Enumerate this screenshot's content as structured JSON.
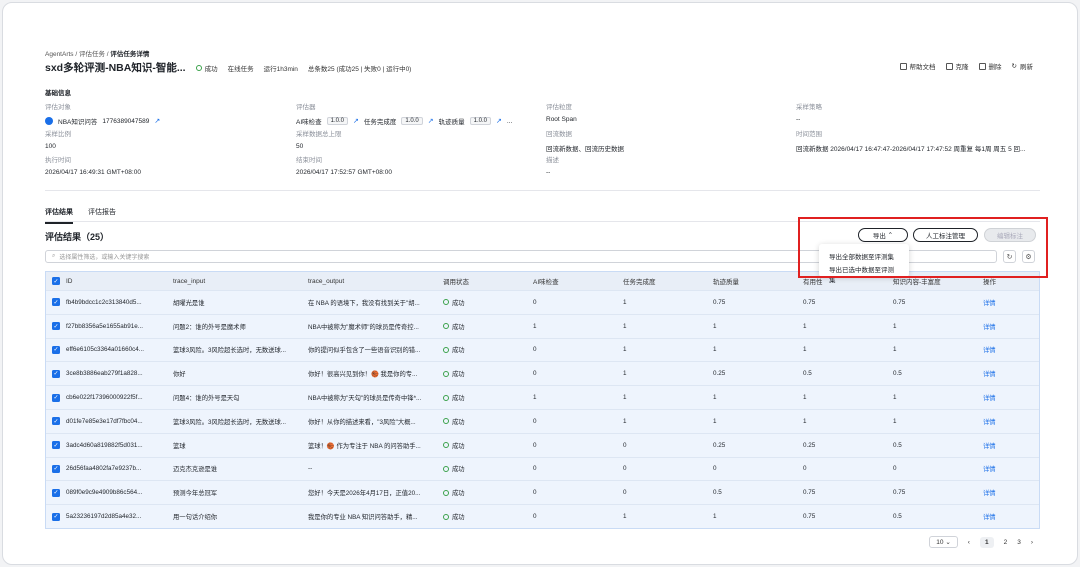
{
  "breadcrumb": [
    "AgentArts",
    "评估任务",
    "评估任务详情"
  ],
  "header": {
    "title": "sxd多轮评测-NBA知识-智能...",
    "status": "成功",
    "task_type": "在线任务",
    "duration": "运行1h3min",
    "summary": "总条数25 (成功25 | 失败0 | 运行中0)",
    "actions": [
      "帮助文档",
      "克隆",
      "删除",
      "刷新"
    ]
  },
  "basic": {
    "section_title": "基础信息",
    "fields": [
      {
        "label": "评估对象",
        "value": "NBA知识问答",
        "extra": "1776389047589"
      },
      {
        "label": "评估器",
        "items": [
          {
            "name": "AI味检查",
            "ver": "1.0.0"
          },
          {
            "name": "任务完成度",
            "ver": "1.0.0"
          },
          {
            "name": "轨迹质量",
            "ver": "1.0.0"
          }
        ],
        "more": "..."
      },
      {
        "label": "评估粒度",
        "value": "Root Span"
      },
      {
        "label": "采样策略",
        "value": "--"
      },
      {
        "label": "采样比例",
        "value": "100"
      },
      {
        "label": "采样数据总上限",
        "value": "50"
      },
      {
        "label": "回流数据",
        "value": "回流新数据、回流历史数据"
      },
      {
        "label": "时间范围",
        "value": "回流新数据 2026/04/17 16:47:47-2026/04/17 17:47:52 周重复 每1周 周五 5 回..."
      },
      {
        "label": "执行时间",
        "value": "2026/04/17 16:49:31 GMT+08:00"
      },
      {
        "label": "结束时间",
        "value": "2026/04/17 17:52:57 GMT+08:00"
      },
      {
        "label": "描述",
        "value": "--"
      }
    ]
  },
  "tabs": [
    "评估结果",
    "评估报告"
  ],
  "results": {
    "title": "评估结果（25）",
    "search_placeholder": "选择属性筛选，或输入关键字搜索",
    "export_label": "导出",
    "annotate_label": "人工标注管理",
    "edit_label": "编辑标注",
    "export_menu": [
      "导出全部数据至评测集",
      "导出已选中数据至评测集"
    ],
    "columns": [
      "ID",
      "trace_input",
      "trace_output",
      "调用状态",
      "AI味检查",
      "任务完成度",
      "轨迹质量",
      "有用性",
      "知识内容-丰富度",
      "操作"
    ],
    "rows": [
      [
        "fb4b9bdcc1c2c313840d5...",
        "胡曜光是谁",
        "在 NBA 的语境下，我没有找到关于\"胡...",
        "成功",
        "0",
        "1",
        "0.75",
        "0.75",
        "0.75",
        "详情"
      ],
      [
        "f27bb8356a5e1655ab91e...",
        "问题2：谁的外号是魔术师",
        "NBA中被称为\"魔术师\"的球员是传奇控...",
        "成功",
        "1",
        "1",
        "1",
        "1",
        "1",
        "详情"
      ],
      [
        "eff6e6105c3364a01660c4...",
        "篮球3风险。3风险超长选时，无数送球...",
        "你的提问似乎包含了一些语音识别的错...",
        "成功",
        "0",
        "1",
        "1",
        "1",
        "1",
        "详情"
      ],
      [
        "3ce8b3886eab279f1a828...",
        "你好",
        "你好！很高兴见到你！🏀 我是你的专...",
        "成功",
        "0",
        "1",
        "0.25",
        "0.5",
        "0.5",
        "详情"
      ],
      [
        "cb6e022f17396000922f5f...",
        "问题4：谁的外号是天勾",
        "NBA中被称为\"天勾\"的球员是传奇中锋*...",
        "成功",
        "1",
        "1",
        "1",
        "1",
        "1",
        "详情"
      ],
      [
        "d01fe7e85e3e17df7fbc04...",
        "篮球3风险。3风险超长选时，无数送球...",
        "你好！从你的描述来看，\"3风险\"大概...",
        "成功",
        "0",
        "1",
        "1",
        "1",
        "1",
        "详情"
      ],
      [
        "3adc4d60a819882f5d031...",
        "篮球",
        "篮球！🏀 作为专注于 NBA 的问答助手...",
        "成功",
        "0",
        "0",
        "0.25",
        "0.25",
        "0.5",
        "详情"
      ],
      [
        "26d56faa4802fa7e9237b...",
        "迈克杰克逊是谁",
        "--",
        "成功",
        "0",
        "0",
        "0",
        "0",
        "0",
        "详情"
      ],
      [
        "089f0e9c9e4909b86c564...",
        "预测今年总冠军",
        "您好！今天是2026年4月17日，正值20...",
        "成功",
        "0",
        "0",
        "0.5",
        "0.75",
        "0.75",
        "详情"
      ],
      [
        "5a23236197d2d85a4e32...",
        "用一句话介绍你",
        "我是你的专业 NBA 知识问答助手，精...",
        "成功",
        "0",
        "1",
        "1",
        "0.75",
        "0.5",
        "详情"
      ]
    ]
  },
  "pager": {
    "size": "10",
    "pages": [
      "1",
      "2",
      "3"
    ],
    "current": "1"
  }
}
